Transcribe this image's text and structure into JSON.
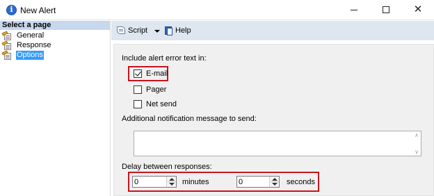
{
  "window": {
    "title": "New Alert",
    "minimize": "—",
    "close": "✕"
  },
  "sidebar": {
    "header": "Select a page",
    "items": [
      {
        "label": "General",
        "selected": false
      },
      {
        "label": "Response",
        "selected": false
      },
      {
        "label": "Options",
        "selected": true
      }
    ]
  },
  "toolbar": {
    "script_label": "Script",
    "help_label": "Help"
  },
  "options": {
    "include_error_label": "Include alert error text in:",
    "checkboxes": [
      {
        "label": "E-mail",
        "checked": true
      },
      {
        "label": "Pager",
        "checked": false
      },
      {
        "label": "Net send",
        "checked": false
      }
    ],
    "additional_msg_label": "Additional notification message to send:",
    "additional_msg_value": "",
    "scroll_up": "∧",
    "scroll_down": "∨",
    "delay_label": "Delay between responses:",
    "minutes_value": "0",
    "minutes_label": "minutes",
    "seconds_value": "0",
    "seconds_label": "seconds"
  },
  "colors": {
    "highlight_border": "#c8141e",
    "selected_item_bg": "#3399ff",
    "toolbar_bg": "#dee6ef",
    "header_bg": "#c6d7ee"
  }
}
